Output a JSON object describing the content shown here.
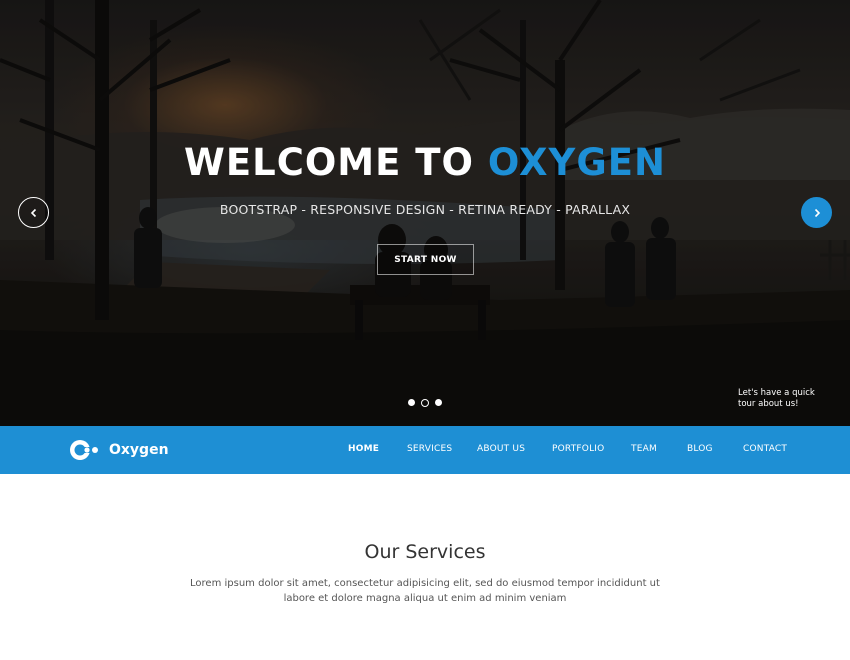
{
  "hero": {
    "title_prefix": "WELCOME TO",
    "title_accent": "OXYGEN",
    "subtitle": "BOOTSTRAP - RESPONSIVE DESIGN - RETINA READY - PARALLAX",
    "cta_label": "START NOW",
    "prev_icon": "chevron-left-icon",
    "next_icon": "chevron-right-icon",
    "slides_count": 3,
    "active_slide": 2,
    "tour_text_line1": "Let's have a quick",
    "tour_text_line2": "tour about us!"
  },
  "brand": {
    "name": "Oxygen",
    "logo_icon": "oxygen-logo-icon"
  },
  "nav": {
    "items": [
      {
        "label": "HOME",
        "active": true
      },
      {
        "label": "SERVICES",
        "active": false
      },
      {
        "label": "ABOUT US",
        "active": false
      },
      {
        "label": "PORTFOLIO",
        "active": false
      },
      {
        "label": "TEAM",
        "active": false
      },
      {
        "label": "BLOG",
        "active": false
      },
      {
        "label": "CONTACT",
        "active": false
      }
    ]
  },
  "services": {
    "title": "Our Services",
    "description": "Lorem ipsum dolor sit amet, consectetur adipisicing elit, sed do eiusmod tempor incididunt ut labore et dolore magna aliqua ut enim ad minim veniam"
  },
  "colors": {
    "accent": "#1d8fd6",
    "nav_bg": "#1e8fd4",
    "hero_dark": "#1c1a19"
  }
}
